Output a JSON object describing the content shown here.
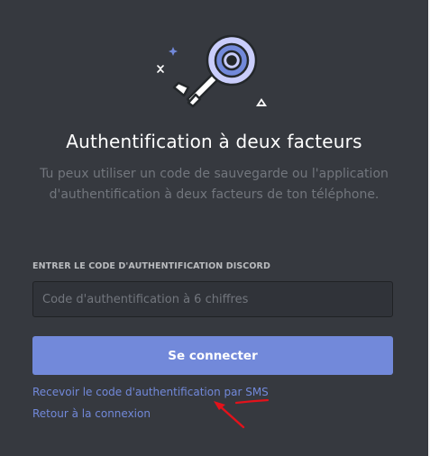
{
  "title": "Authentification à deux facteurs",
  "subtitle": "Tu peux utiliser un code de sauvegarde ou l'application d'authentification à deux facteurs de ton téléphone.",
  "field": {
    "label": "ENTRER LE CODE D'AUTHENTIFICATION DISCORD",
    "placeholder": "Code d'authentification à 6 chiffres",
    "value": ""
  },
  "login_button": "Se connecter",
  "links": {
    "sms": "Recevoir le code d'authentification par SMS",
    "back": "Retour à la connexion"
  },
  "colors": {
    "background": "#36393f",
    "accent": "#7289da",
    "annotation": "#e3121b"
  },
  "icons": [
    "key-icon",
    "sparkle-icon",
    "triangle-icon"
  ]
}
